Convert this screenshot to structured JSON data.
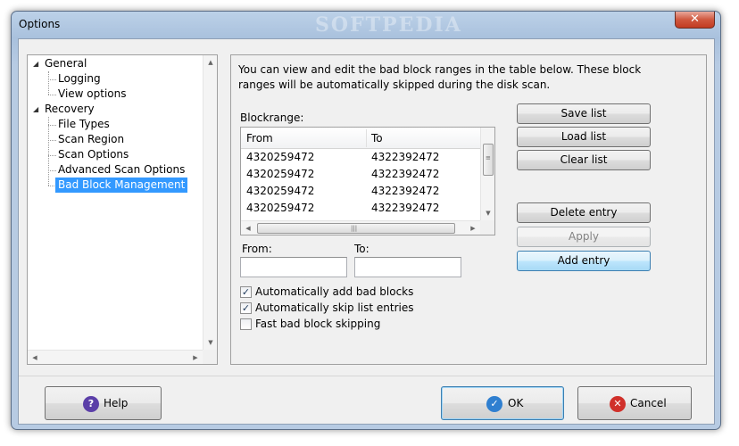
{
  "window": {
    "title": "Options",
    "watermark": "SOFTPEDIA"
  },
  "tree": {
    "items": [
      {
        "label": "General"
      },
      {
        "label": "Logging"
      },
      {
        "label": "View options"
      },
      {
        "label": "Recovery"
      },
      {
        "label": "File Types"
      },
      {
        "label": "Scan Region"
      },
      {
        "label": "Scan Options"
      },
      {
        "label": "Advanced Scan Options"
      },
      {
        "label": "Bad Block Management"
      }
    ]
  },
  "panel": {
    "description": "You can view and edit the bad block ranges in the table below. These block ranges will be automatically skipped during the disk scan.",
    "blockrange_label": "Blockrange:",
    "table": {
      "columns": [
        "From",
        "To"
      ],
      "rows": [
        [
          "4320259472",
          "4322392472"
        ],
        [
          "4320259472",
          "4322392472"
        ],
        [
          "4320259472",
          "4322392472"
        ],
        [
          "4320259472",
          "4322392472"
        ]
      ]
    },
    "from_label": "From:",
    "to_label": "To:",
    "from_value": "",
    "to_value": "",
    "checkboxes": [
      {
        "label": "Automatically add bad blocks",
        "checked": true
      },
      {
        "label": "Automatically skip list entries",
        "checked": true
      },
      {
        "label": "Fast bad block skipping",
        "checked": false
      }
    ],
    "buttons": {
      "save_list": "Save list",
      "load_list": "Load list",
      "clear_list": "Clear list",
      "delete_entry": "Delete entry",
      "apply": "Apply",
      "add_entry": "Add entry"
    }
  },
  "footer": {
    "help": "Help",
    "ok": "OK",
    "cancel": "Cancel"
  },
  "colors": {
    "selection": "#3399ff",
    "help_icon": "#5b3fa8",
    "ok_icon": "#2f7fd0",
    "cancel_icon": "#d0302a"
  }
}
